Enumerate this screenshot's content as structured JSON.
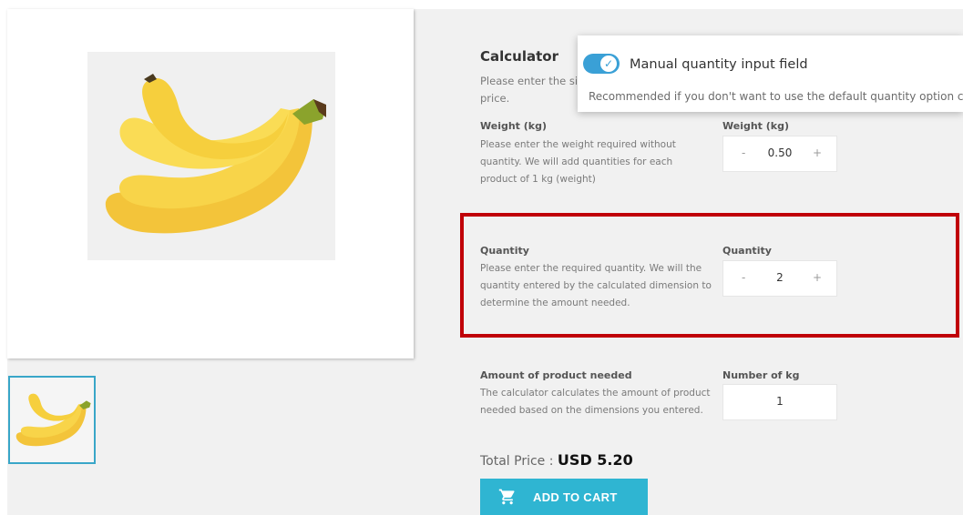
{
  "calculator": {
    "title": "Calculator",
    "description_line1": "Please enter the siz",
    "description_line2": "price."
  },
  "weight": {
    "label": "Weight (kg)",
    "desc_lines": [
      "Please enter the weight required without",
      "quantity. We will add quantities for each",
      "product of 1 kg (weight)"
    ],
    "input_label": "Weight (kg)",
    "minus": "-",
    "value": "0.50",
    "plus": "+"
  },
  "quantity": {
    "label": "Quantity",
    "desc_lines": [
      "Please enter the required quantity. We will the",
      "quantity entered by the calculated dimension to",
      "determine the amount needed."
    ],
    "input_label": "Quantity",
    "minus": "-",
    "value": "2",
    "plus": "+"
  },
  "amount": {
    "label": "Amount of product needed",
    "desc_lines": [
      "The calculator calculates the amount of product",
      "needed based on the dimensions you entered."
    ],
    "input_label": "Number of kg",
    "value": "1"
  },
  "tooltip": {
    "toggle_label": "Manual quantity input field",
    "help_text": "Recommended if you don't want to use the default quantity option c",
    "toggle_on": true
  },
  "total": {
    "label": "Total Price : ",
    "value": "USD 5.20"
  },
  "cart_button": {
    "label": "ADD TO CART"
  },
  "colors": {
    "accent": "#2fb5d2",
    "highlight_border": "#c00008",
    "toggle": "#3aa0d6"
  },
  "icons": {
    "cart": "shopping-cart-icon",
    "check": "checkmark-icon"
  }
}
